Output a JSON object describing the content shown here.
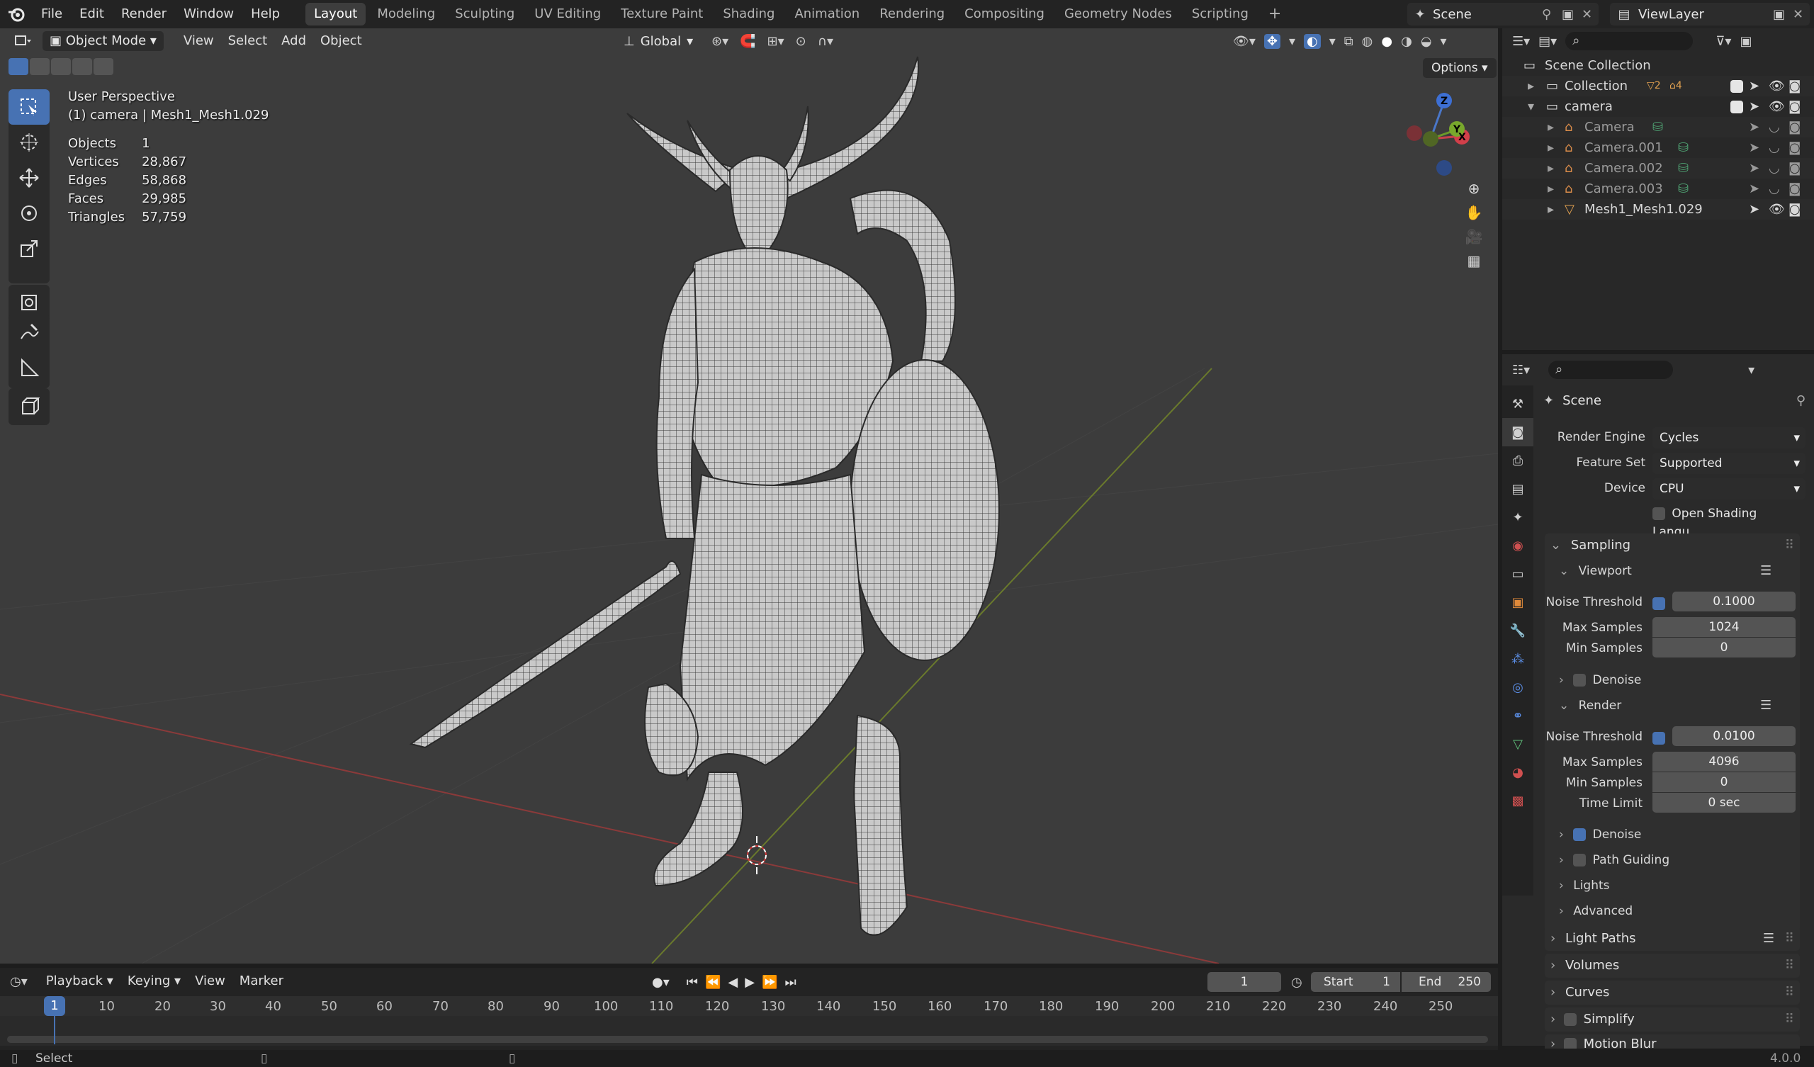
{
  "menu": [
    "File",
    "Edit",
    "Render",
    "Window",
    "Help"
  ],
  "workspaces": [
    {
      "label": "Layout",
      "active": true
    },
    {
      "label": "Modeling",
      "active": false
    },
    {
      "label": "Sculpting",
      "active": false
    },
    {
      "label": "UV Editing",
      "active": false
    },
    {
      "label": "Texture Paint",
      "active": false
    },
    {
      "label": "Shading",
      "active": false
    },
    {
      "label": "Animation",
      "active": false
    },
    {
      "label": "Rendering",
      "active": false
    },
    {
      "label": "Compositing",
      "active": false
    },
    {
      "label": "Geometry Nodes",
      "active": false
    },
    {
      "label": "Scripting",
      "active": false
    }
  ],
  "scene_selector": "Scene",
  "viewlayer_selector": "ViewLayer",
  "viewport_header": {
    "mode": "Object Mode",
    "menus": [
      "View",
      "Select",
      "Add",
      "Object"
    ],
    "transform_orientation": "Global",
    "options_label": "Options"
  },
  "overlay_info": {
    "view_name": "User Perspective",
    "active_object": "(1) camera | Mesh1_Mesh1.029",
    "stats": [
      {
        "label": "Objects",
        "value": "1"
      },
      {
        "label": "Vertices",
        "value": "28,867"
      },
      {
        "label": "Edges",
        "value": "58,868"
      },
      {
        "label": "Faces",
        "value": "29,985"
      },
      {
        "label": "Triangles",
        "value": "57,759"
      }
    ]
  },
  "gizmo": {
    "x": "X",
    "y": "Y",
    "z": "Z"
  },
  "outliner": {
    "root": "Scene Collection",
    "items": [
      {
        "name": "Collection",
        "badge1": "2",
        "badge2": "4"
      },
      {
        "name": "camera"
      },
      {
        "name": "Camera"
      },
      {
        "name": "Camera.001"
      },
      {
        "name": "Camera.002"
      },
      {
        "name": "Camera.003"
      },
      {
        "name": "Mesh1_Mesh1.029"
      }
    ]
  },
  "properties": {
    "context": "Scene",
    "render_engine_label": "Render Engine",
    "render_engine": "Cycles",
    "feature_set_label": "Feature Set",
    "feature_set": "Supported",
    "device_label": "Device",
    "device": "CPU",
    "osl_label": "Open Shading Langu...",
    "sampling": "Sampling",
    "viewport": "Viewport",
    "noise_threshold_label": "Noise Threshold",
    "vp_noise_threshold": "0.1000",
    "max_samples_label": "Max Samples",
    "vp_max_samples": "1024",
    "min_samples_label": "Min Samples",
    "vp_min_samples": "0",
    "denoise": "Denoise",
    "render": "Render",
    "r_noise_threshold": "0.0100",
    "r_max_samples": "4096",
    "r_min_samples": "0",
    "time_limit_label": "Time Limit",
    "r_time_limit": "0 sec",
    "path_guiding": "Path Guiding",
    "lights": "Lights",
    "advanced": "Advanced",
    "light_paths": "Light Paths",
    "volumes": "Volumes",
    "curves": "Curves",
    "simplify": "Simplify",
    "motion_blur": "Motion Blur"
  },
  "timeline": {
    "menus": [
      "Playback",
      "Keying",
      "View",
      "Marker"
    ],
    "current_frame": "1",
    "start_label": "Start",
    "start": "1",
    "end_label": "End",
    "end": "250",
    "ticks": [
      "1",
      "10",
      "20",
      "30",
      "40",
      "50",
      "60",
      "70",
      "80",
      "90",
      "100",
      "110",
      "120",
      "130",
      "140",
      "150",
      "160",
      "170",
      "180",
      "190",
      "200",
      "210",
      "220",
      "230",
      "240",
      "250"
    ]
  },
  "status": {
    "left": "Select",
    "version": "4.0.0"
  }
}
